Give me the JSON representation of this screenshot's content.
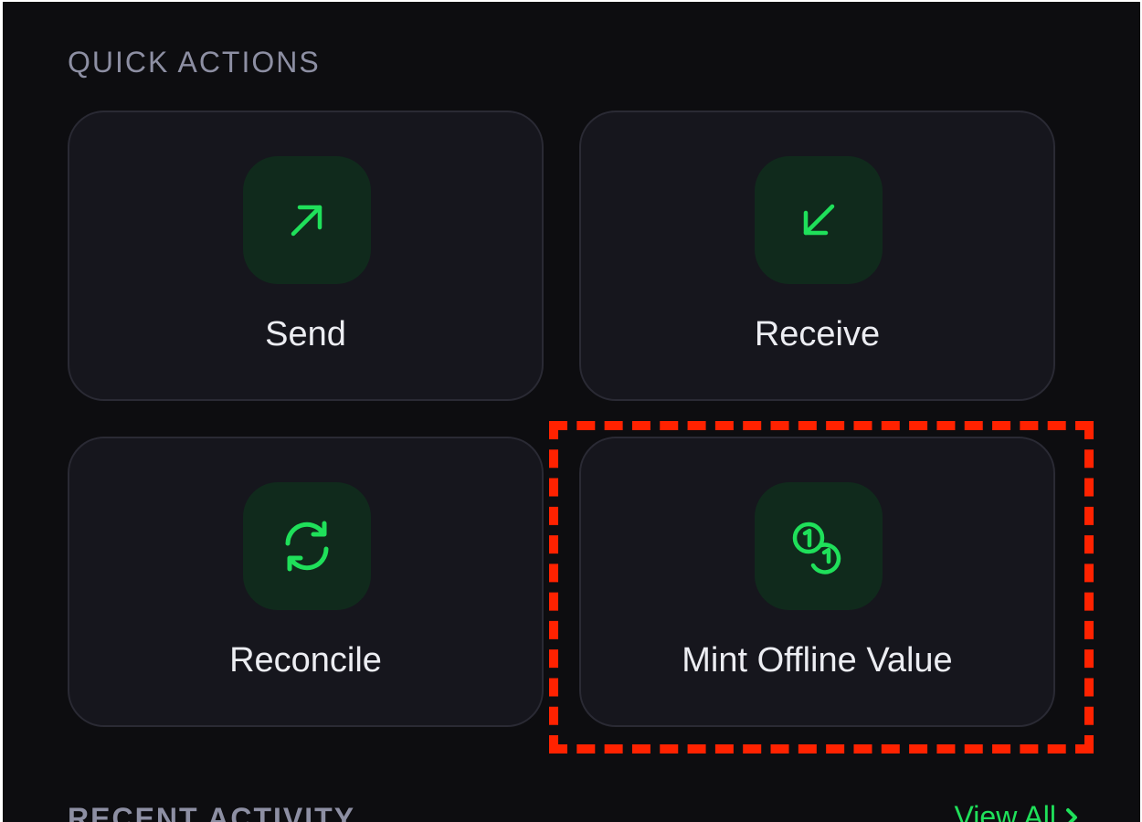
{
  "quick_actions": {
    "title": "QUICK ACTIONS",
    "actions": [
      {
        "label": "Send",
        "icon": "arrow-up-right-icon"
      },
      {
        "label": "Receive",
        "icon": "arrow-down-left-icon"
      },
      {
        "label": "Reconcile",
        "icon": "refresh-icon"
      },
      {
        "label": "Mint Offline Value",
        "icon": "coins-icon"
      }
    ]
  },
  "recent_activity": {
    "title": "RECENT ACTIVITY",
    "view_all_label": "View All",
    "view_all_icon": "chevron-right-icon"
  },
  "colors": {
    "background": "#0d0d10",
    "card": "#16161d",
    "accent": "#1fe05a",
    "icon_tile": "#102a1c",
    "highlight": "#ff2200"
  }
}
